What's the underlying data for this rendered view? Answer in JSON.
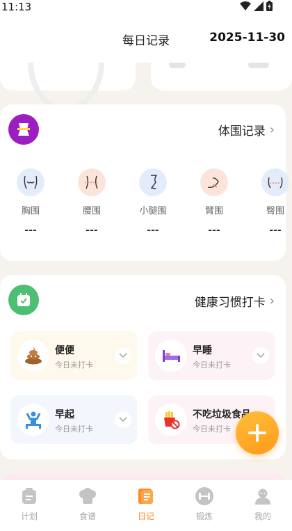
{
  "status_bar": {
    "time": "11:13"
  },
  "header": {
    "title": "每日记录",
    "date": "2025-11-30"
  },
  "body_section": {
    "title": "体围记录",
    "items": [
      {
        "label": "胸围",
        "value": "---",
        "icon": "chest-icon",
        "color": "#e3ecfb"
      },
      {
        "label": "腰围",
        "value": "---",
        "icon": "waist-icon",
        "color": "#fde4da"
      },
      {
        "label": "小腿围",
        "value": "---",
        "icon": "calf-icon",
        "color": "#e3ecfb"
      },
      {
        "label": "臂围",
        "value": "---",
        "icon": "arm-icon",
        "color": "#fde4da"
      },
      {
        "label": "臀围",
        "value": "---",
        "icon": "hip-icon",
        "color": "#e3ecfb"
      }
    ]
  },
  "habit_section": {
    "title": "健康习惯打卡",
    "items": [
      {
        "name": "便便",
        "status": "今日未打卡",
        "icon": "poop-icon",
        "bg": "#fef9ec"
      },
      {
        "name": "早睡",
        "status": "今日未打卡",
        "icon": "bed-icon",
        "bg": "#fdf3f6"
      },
      {
        "name": "早起",
        "status": "今日未打卡",
        "icon": "wake-up-icon",
        "bg": "#f3f6fc"
      },
      {
        "name": "不吃垃圾食品",
        "status": "今日未打卡",
        "icon": "no-junk-food-icon",
        "bg": "#fdf3f6"
      }
    ]
  },
  "tabs": [
    {
      "label": "计划",
      "icon": "plan-icon",
      "active": false
    },
    {
      "label": "食谱",
      "icon": "chef-icon",
      "active": false
    },
    {
      "label": "日记",
      "icon": "diary-icon",
      "active": true
    },
    {
      "label": "锻炼",
      "icon": "dumbbell-icon",
      "active": false
    },
    {
      "label": "我的",
      "icon": "profile-icon",
      "active": false
    }
  ],
  "colors": {
    "accent": "#ff8a1f",
    "body_icon_bg": "#9b1fc0",
    "habit_icon_bg": "#4dbf73"
  }
}
